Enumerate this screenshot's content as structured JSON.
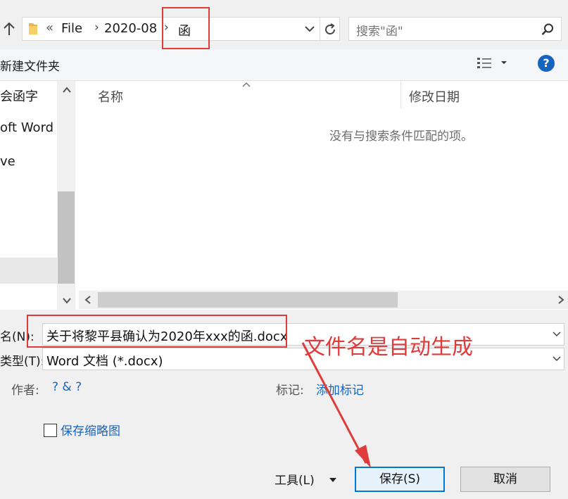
{
  "address_bar": {
    "overflow_chevron": "«",
    "breadcrumbs": [
      {
        "label": "File"
      },
      {
        "label": "2020-08"
      },
      {
        "label": "函"
      }
    ],
    "separator": "›"
  },
  "search": {
    "placeholder": "搜索\"函\""
  },
  "toolbar": {
    "new_folder_label": "新建文件夹",
    "help_label": "?"
  },
  "nav_pane": {
    "items": [
      {
        "label": "会函字"
      },
      {
        "label": "oft Word"
      },
      {
        "label": "ve"
      }
    ]
  },
  "file_list": {
    "columns": [
      {
        "label": "名称"
      },
      {
        "label": "修改日期"
      }
    ],
    "empty_message": "没有与搜索条件匹配的项。"
  },
  "form": {
    "filename_label": "名(N):",
    "filename_value": "关于将黎平县确认为2020年xxx的函.docx",
    "filetype_label": "类型(T):",
    "filetype_value": "Word 文档 (*.docx)",
    "author_label": "作者:",
    "author_value": "? & ?",
    "tags_label": "标记:",
    "tags_value": "添加标记",
    "thumbnail_label": "保存缩略图",
    "thumbnail_checked": false
  },
  "buttons": {
    "tools_label": "工具(L)",
    "save_label": "保存(S)",
    "cancel_label": "取消"
  },
  "annotation": {
    "text": "文件名是自动生成",
    "color": "#e03b3b"
  },
  "colors": {
    "accent": "#0078d7",
    "link": "#1565c0",
    "folder": "#e8b64d"
  }
}
